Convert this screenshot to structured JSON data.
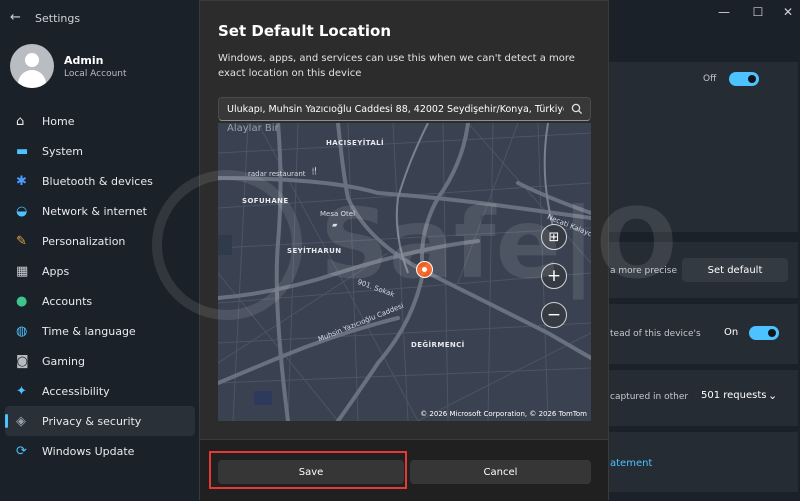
{
  "window": {
    "app_title": "Settings",
    "controls": {
      "minimize": "—",
      "maximize": "☐",
      "close": "✕"
    }
  },
  "profile": {
    "name": "Admin",
    "account_type": "Local Account"
  },
  "sidebar": {
    "items": [
      {
        "label": "Home",
        "icon": "home-icon",
        "glyph": "⌂",
        "color": "#e8eaed"
      },
      {
        "label": "System",
        "icon": "monitor-icon",
        "glyph": "▬",
        "color": "#4cc2ff"
      },
      {
        "label": "Bluetooth & devices",
        "icon": "bluetooth-icon",
        "glyph": "✱",
        "color": "#4c9bff"
      },
      {
        "label": "Network & internet",
        "icon": "wifi-icon",
        "glyph": "◒",
        "color": "#4cc2ff"
      },
      {
        "label": "Personalization",
        "icon": "brush-icon",
        "glyph": "✎",
        "color": "#e0a04c"
      },
      {
        "label": "Apps",
        "icon": "apps-icon",
        "glyph": "▦",
        "color": "#c8ccd2"
      },
      {
        "label": "Accounts",
        "icon": "person-icon",
        "glyph": "●",
        "color": "#3fc48c"
      },
      {
        "label": "Time & language",
        "icon": "globe-icon",
        "glyph": "◍",
        "color": "#4cc2ff"
      },
      {
        "label": "Gaming",
        "icon": "gamepad-icon",
        "glyph": "◙",
        "color": "#b7bcc2"
      },
      {
        "label": "Accessibility",
        "icon": "accessibility-icon",
        "glyph": "✦",
        "color": "#4cc2ff"
      },
      {
        "label": "Privacy & security",
        "icon": "shield-icon",
        "glyph": "◈",
        "color": "#9aa0a8",
        "active": true
      },
      {
        "label": "Windows Update",
        "icon": "update-icon",
        "glyph": "⟳",
        "color": "#4cc2ff"
      }
    ]
  },
  "background_content": {
    "toggle_top_state": "Off",
    "default_location_desc": "a more precise",
    "set_default_label": "Set default",
    "override_desc": "tead of this device's",
    "override_state": "On",
    "requests_desc": "captured in other",
    "requests_value": "501 requests",
    "privacy_link": "atement"
  },
  "dialog": {
    "title": "Set Default Location",
    "description": "Windows, apps, and services can use this when we can't detect a more exact location on this device",
    "location_value": "Ulukapı, Muhsin Yazıcıoğlu Caddesi 88, 42002 Seydişehir/Konya, Türkiye",
    "map": {
      "labels": {
        "alaylar": "Alaylar Bir",
        "hacıseyitali": "HACISEYİTALİ",
        "radar": "radar restaurant",
        "sofuhane": "SOFUHANE",
        "mesa": "Mesa Otel",
        "seyitharun": "SEYİTHARUN",
        "sokak": "901. Sokak",
        "muhsin": "Muhsin Yazıcıoğlu Caddesi",
        "degirmenci": "DEĞİRMENCİ",
        "necati": "Necati Kalaycı"
      },
      "attribution": "© 2026 Microsoft Corporation, © 2026 TomTom",
      "controls": {
        "layers": "⊞",
        "zoom_in": "+",
        "zoom_out": "−"
      }
    },
    "save_label": "Save",
    "cancel_label": "Cancel"
  },
  "watermark": {
    "text": "Safe|O"
  },
  "colors": {
    "accent": "#4cc2ff",
    "pin": "#f25c1e",
    "highlight": "#e53935"
  }
}
